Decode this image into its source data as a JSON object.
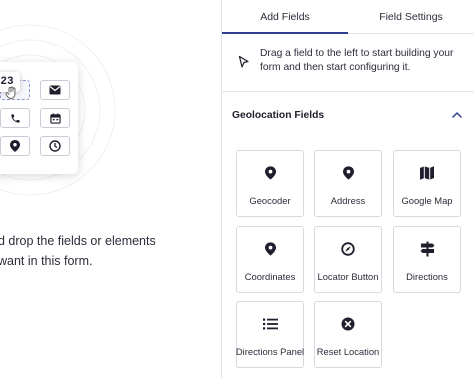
{
  "canvas": {
    "chip_text": "23",
    "hint_lines": [
      "d drop the fields or elements",
      "want in this form."
    ]
  },
  "panel": {
    "tabs": [
      {
        "label": "Add Fields",
        "active": true
      },
      {
        "label": "Field Settings",
        "active": false
      }
    ],
    "tip_text": "Drag a field to the left to start building your form and then start configuring it.",
    "section_title": "Geolocation Fields",
    "fields": [
      {
        "label": "Geocoder",
        "icon": "map-pin-icon"
      },
      {
        "label": "Address",
        "icon": "map-pin-icon"
      },
      {
        "label": "Google Map",
        "icon": "map-icon"
      },
      {
        "label": "Coordinates",
        "icon": "map-pin-icon"
      },
      {
        "label": "Locator Button",
        "icon": "locate-icon"
      },
      {
        "label": "Directions",
        "icon": "signpost-icon"
      },
      {
        "label": "Directions Panel",
        "icon": "list-icon"
      },
      {
        "label": "Reset Location",
        "icon": "close-circle-icon"
      }
    ]
  },
  "colors": {
    "accent": "#2e3e8f",
    "border": "#d7d9e0",
    "text": "#2b2d3a"
  }
}
